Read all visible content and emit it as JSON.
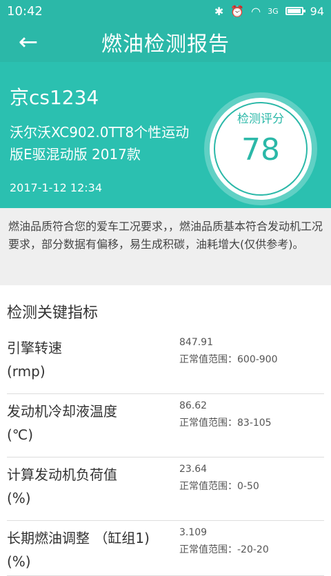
{
  "status": {
    "time": "10:42",
    "battery": "94",
    "signal_label": "3G",
    "battery_level": 0.94
  },
  "header": {
    "back_glyph": "←",
    "title": "燃油检测报告"
  },
  "hero": {
    "plate": "京cs1234",
    "model": "沃尔沃XC902.0TT8个性运动版E驱混动版 2017款",
    "date": "2017-1-12 12:34",
    "score_label": "检测评分",
    "score_value": "78"
  },
  "summary": "燃油品质符合您的爱车工况要求，，燃油品质基本符合发动机工况要求，部分数据有偏移，易生成积碳，油耗增大(仅供参考)。",
  "section_title": "检测关键指标",
  "metrics": [
    {
      "name": "引擎转速",
      "unit": "(rmp)",
      "value": "847.91",
      "range": "正常值范围：600-900"
    },
    {
      "name": "发动机冷却液温度",
      "unit": "(℃)",
      "value": "86.62",
      "range": "正常值范围：83-105"
    },
    {
      "name": "计算发动机负荷值",
      "unit": "(%)",
      "value": "23.64",
      "range": "正常值范围：0-50"
    },
    {
      "name": "长期燃油调整 （缸组1)",
      "unit": "(%)",
      "value": "3.109",
      "range": "正常值范围：-20-20"
    }
  ],
  "colors": {
    "primary": "#2bb8a8",
    "hero": "#2bc0b0",
    "summary_bg": "#efefef"
  }
}
